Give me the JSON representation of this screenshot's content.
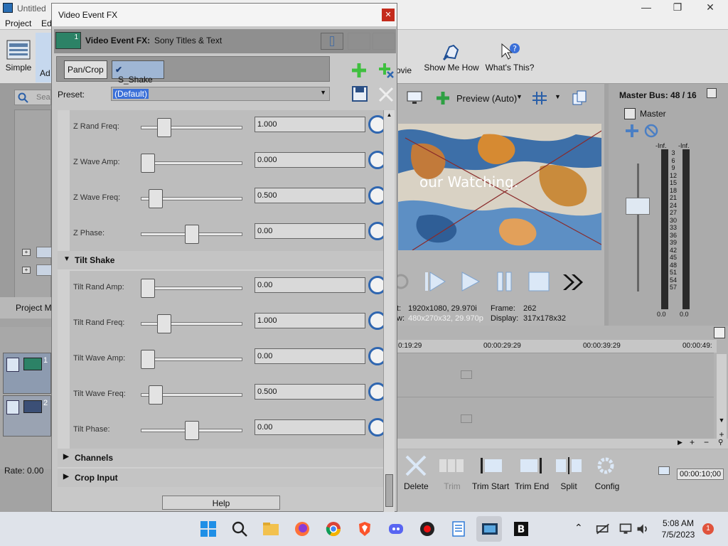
{
  "app": {
    "title": "Untitled",
    "menu": [
      "Project",
      "Ed"
    ],
    "toolbar": {
      "simple_label": "Simple",
      "advanced_label": "Ad",
      "movie_label": "ovie",
      "show_me_how_label": "Show Me How",
      "whats_this_label": "What's This?"
    },
    "left_panel": {
      "search_placeholder": "Sea",
      "project_media_label": "Project Me"
    },
    "tracks": [
      {
        "number": "1"
      },
      {
        "number": "2"
      }
    ],
    "rate_label": "Rate: 0.00"
  },
  "preview": {
    "mode_label": "Preview (Auto)",
    "overlay_text": "our Watching.",
    "info": {
      "project_label": "t:",
      "project_value": "1920x1080, 29.970i",
      "preview_label": "w:",
      "preview_value": "480x270x32, 29.970p",
      "frame_label": "Frame:",
      "frame_value": "262",
      "display_label": "Display:",
      "display_value": "317x178x32"
    }
  },
  "master_bus": {
    "title": "Master Bus: 48 / 16",
    "master_label": "Master",
    "left_peak": "-Inf.",
    "right_peak": "-Inf.",
    "left_value": "0.0",
    "right_value": "0.0",
    "scale": [
      "3",
      "6",
      "9",
      "12",
      "15",
      "18",
      "21",
      "24",
      "27",
      "30",
      "33",
      "36",
      "39",
      "42",
      "45",
      "48",
      "51",
      "54",
      "57"
    ]
  },
  "timeline": {
    "ruler": [
      "0:19:29",
      "00:00:29:29",
      "00:00:39:29",
      "00:00:49:"
    ],
    "timecode": "00:00:10;00"
  },
  "edit_toolbar": [
    {
      "label": "Delete"
    },
    {
      "label": "Trim"
    },
    {
      "label": "Trim Start"
    },
    {
      "label": "Trim End"
    },
    {
      "label": "Split"
    },
    {
      "label": "Config"
    }
  ],
  "fx_dialog": {
    "title": "Video Event FX",
    "close_glyph": "✕",
    "header_bold": "Video Event FX:",
    "header_plugin": "Sony Titles & Text",
    "chip_number": "1",
    "chain": [
      {
        "label": "Pan/Crop"
      },
      {
        "label": "S_Shake"
      }
    ],
    "preset_label": "Preset:",
    "preset_value": "(Default)",
    "z_rows": [
      {
        "label": "Z Rand Freq:",
        "value": "1.000",
        "fraction": 0.19
      },
      {
        "label": "Z Wave Amp:",
        "value": "0.000",
        "fraction": 0.0
      },
      {
        "label": "Z Wave Freq:",
        "value": "0.500",
        "fraction": 0.09
      },
      {
        "label": "Z Phase:",
        "value": "0.00",
        "fraction": 0.5
      }
    ],
    "tilt_section": "Tilt Shake",
    "tilt_rows": [
      {
        "label": "Tilt Rand Amp:",
        "value": "0.00",
        "fraction": 0.0
      },
      {
        "label": "Tilt Rand Freq:",
        "value": "1.000",
        "fraction": 0.19
      },
      {
        "label": "Tilt Wave Amp:",
        "value": "0.00",
        "fraction": 0.0
      },
      {
        "label": "Tilt Wave Freq:",
        "value": "0.500",
        "fraction": 0.09
      },
      {
        "label": "Tilt Phase:",
        "value": "0.00",
        "fraction": 0.5
      }
    ],
    "collapsed_sections": [
      "Channels",
      "Crop Input"
    ],
    "help_label": "Help"
  },
  "taskbar": {
    "time": "5:08 AM",
    "date": "7/5/2023",
    "notification_count": "1"
  },
  "colors": {
    "accent_blue": "#2f66b0",
    "chip_green": "#2c8266",
    "close_red": "#c42b1c"
  }
}
